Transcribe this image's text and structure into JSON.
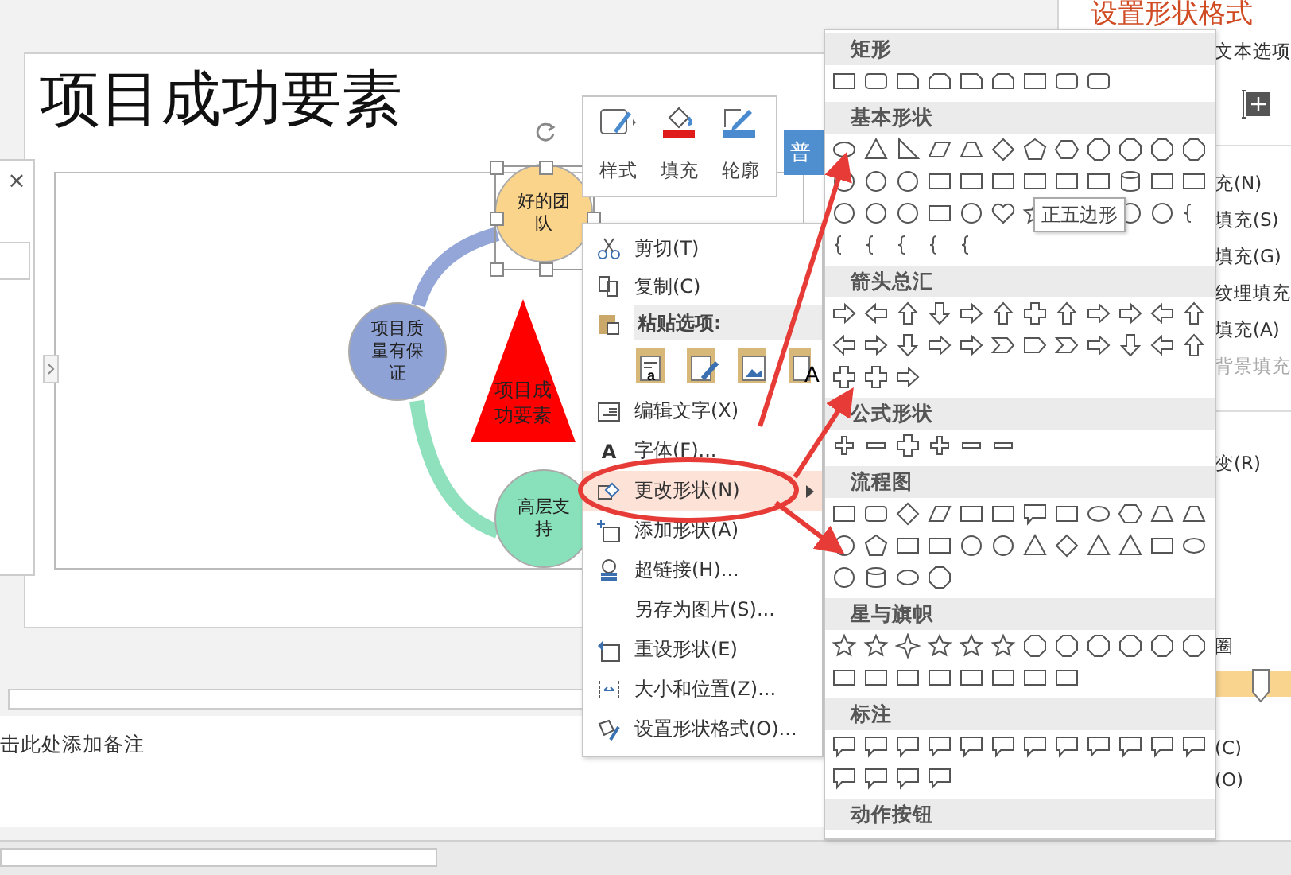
{
  "slide": {
    "title": "项目成功要素",
    "nodes": [
      {
        "label": "好的团队",
        "color": "#fbd48b",
        "selected": true
      },
      {
        "label": "项目质量有保证",
        "color": "#8fa2d6",
        "selected": false
      },
      {
        "label": "高层支持",
        "color": "#88e1ba",
        "selected": false
      }
    ],
    "center_shape": {
      "label": "项目成功要素"
    }
  },
  "thumbnail_pane": {
    "close": "×"
  },
  "mini_toolbar": {
    "buttons": [
      {
        "label": "样式"
      },
      {
        "label": "填充",
        "color": "#e01b1b"
      },
      {
        "label": "轮廓",
        "color": "#4a8bd0"
      }
    ],
    "side_button": "普"
  },
  "context_menu": {
    "items": [
      {
        "kind": "item",
        "label": "剪切(T)",
        "selected": false
      },
      {
        "kind": "item",
        "label": "复制(C)",
        "selected": false
      },
      {
        "kind": "header",
        "label": "粘贴选项:"
      },
      {
        "kind": "paste-options",
        "options": [
          {
            "kind": "keep-source",
            "char": "a"
          },
          {
            "kind": "merge-format"
          },
          {
            "kind": "picture"
          },
          {
            "kind": "text-only",
            "char": "A"
          }
        ]
      },
      {
        "kind": "item",
        "label": "编辑文字(X)",
        "selected": false
      },
      {
        "kind": "item",
        "label": "字体(F)...",
        "icon_char": "A",
        "selected": false
      },
      {
        "kind": "item",
        "label": "更改形状(N)",
        "submenu": true,
        "selected": true
      },
      {
        "kind": "item",
        "label": "添加形状(A)",
        "selected": false
      },
      {
        "kind": "item",
        "label": "超链接(H)...",
        "selected": false
      },
      {
        "kind": "item",
        "label": "另存为图片(S)...",
        "selected": false
      },
      {
        "kind": "item",
        "label": "重设形状(E)",
        "selected": false
      },
      {
        "kind": "item",
        "label": "大小和位置(Z)...",
        "selected": false
      },
      {
        "kind": "item",
        "label": "设置形状格式(O)...",
        "selected": false
      }
    ]
  },
  "shape_gallery": {
    "sections": [
      {
        "title": "矩形"
      },
      {
        "title": "基本形状"
      },
      {
        "title": "箭头总汇"
      },
      {
        "title": "公式形状"
      },
      {
        "title": "流程图"
      },
      {
        "title": "星与旗帜"
      },
      {
        "title": "标注"
      },
      {
        "title": "动作按钮"
      }
    ],
    "tooltip": "正五边形"
  },
  "format_pane": {
    "title": "设置形状格式",
    "tab": "文本选项",
    "fill_options": [
      {
        "label": "充(N)",
        "disabled": false
      },
      {
        "label": "填充(S)",
        "disabled": false
      },
      {
        "label": "填充(G)",
        "disabled": false
      },
      {
        "label": "纹理填充",
        "disabled": false
      },
      {
        "label": "填充(A)",
        "disabled": false
      },
      {
        "label": "背景填充",
        "disabled": true
      }
    ],
    "option_r": "变(R)",
    "section_label": "圈",
    "slider": {
      "level": 0.6
    },
    "option_c": "(C)",
    "option_o": "(O)"
  },
  "notes": {
    "placeholder": "击此处添加备注"
  }
}
